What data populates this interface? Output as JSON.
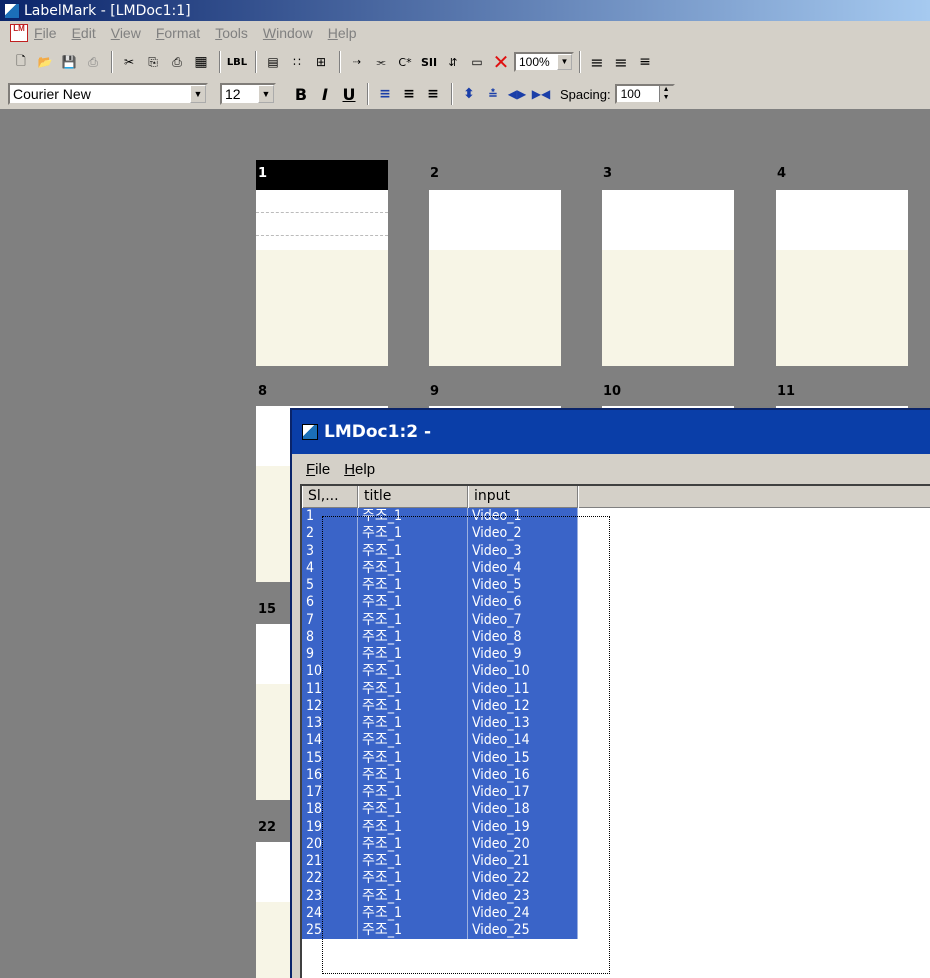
{
  "app": {
    "title": "LabelMark - [LMDoc1:1]"
  },
  "menu": [
    "File",
    "Edit",
    "View",
    "Format",
    "Tools",
    "Window",
    "Help"
  ],
  "toolbar": {
    "zoom": "100%",
    "lbl_button": "LBL",
    "tools": [
      "new-icon",
      "open-icon",
      "save-icon",
      "print-icon",
      "cut-icon",
      "copy-icon",
      "paste-icon",
      "grid-icon",
      "lbl-icon",
      "window-icon",
      "dots-icon",
      "table-icon",
      "arrow-icon",
      "merge-icon",
      "cstar-icon",
      "sii-icon",
      "sort-icon",
      "rect-icon",
      "delete-icon"
    ]
  },
  "format": {
    "font": "Courier New",
    "size": "12",
    "bold": "B",
    "italic": "I",
    "underline": "U",
    "spacing_label": "Spacing:",
    "spacing_value": "100"
  },
  "labels": {
    "row1": [
      "1",
      "2",
      "3",
      "4"
    ],
    "row2": [
      "8",
      "9",
      "10",
      "11"
    ],
    "row3": [
      "15"
    ],
    "row4": [
      "22"
    ]
  },
  "child": {
    "title": "LMDoc1:2 -",
    "menu": [
      "File",
      "Help"
    ],
    "columns": [
      "Sl,...",
      "title",
      "input"
    ],
    "rows": [
      {
        "sl": "1",
        "title": "주조_1",
        "input": "Video_1"
      },
      {
        "sl": "2",
        "title": "주조_1",
        "input": "Video_2"
      },
      {
        "sl": "3",
        "title": "주조_1",
        "input": "Video_3"
      },
      {
        "sl": "4",
        "title": "주조_1",
        "input": "Video_4"
      },
      {
        "sl": "5",
        "title": "주조_1",
        "input": "Video_5"
      },
      {
        "sl": "6",
        "title": "주조_1",
        "input": "Video_6"
      },
      {
        "sl": "7",
        "title": "주조_1",
        "input": "Video_7"
      },
      {
        "sl": "8",
        "title": "주조_1",
        "input": "Video_8"
      },
      {
        "sl": "9",
        "title": "주조_1",
        "input": "Video_9"
      },
      {
        "sl": "10",
        "title": "주조_1",
        "input": "Video_10"
      },
      {
        "sl": "11",
        "title": "주조_1",
        "input": "Video_11"
      },
      {
        "sl": "12",
        "title": "주조_1",
        "input": "Video_12"
      },
      {
        "sl": "13",
        "title": "주조_1",
        "input": "Video_13"
      },
      {
        "sl": "14",
        "title": "주조_1",
        "input": "Video_14"
      },
      {
        "sl": "15",
        "title": "주조_1",
        "input": "Video_15"
      },
      {
        "sl": "16",
        "title": "주조_1",
        "input": "Video_16"
      },
      {
        "sl": "17",
        "title": "주조_1",
        "input": "Video_17"
      },
      {
        "sl": "18",
        "title": "주조_1",
        "input": "Video_18"
      },
      {
        "sl": "19",
        "title": "주조_1",
        "input": "Video_19"
      },
      {
        "sl": "20",
        "title": "주조_1",
        "input": "Video_20"
      },
      {
        "sl": "21",
        "title": "주조_1",
        "input": "Video_21"
      },
      {
        "sl": "22",
        "title": "주조_1",
        "input": "Video_22"
      },
      {
        "sl": "23",
        "title": "주조_1",
        "input": "Video_23"
      },
      {
        "sl": "24",
        "title": "주조_1",
        "input": "Video_24"
      },
      {
        "sl": "25",
        "title": "주조_1",
        "input": "Video_25"
      }
    ]
  }
}
